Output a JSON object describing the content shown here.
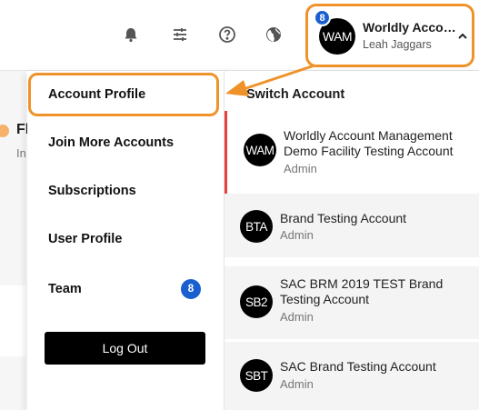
{
  "topbar": {
    "icons": [
      "bell-icon",
      "sliders-icon",
      "help-icon",
      "globe-icon"
    ],
    "account": {
      "avatar_text": "WAM",
      "badge": "8",
      "name": "Worldly Account Management",
      "user": "Leah Jaggars",
      "caret": "chevron-up-icon"
    }
  },
  "background": {
    "heading_fragment": "Fl",
    "sub_fragment": "In"
  },
  "menu": {
    "items": [
      {
        "label": "Account Profile"
      },
      {
        "label": "Join More Accounts"
      },
      {
        "label": "Subscriptions"
      },
      {
        "label": "User Profile"
      },
      {
        "label": "Team",
        "badge": "8"
      }
    ],
    "logout_label": "Log Out"
  },
  "switch": {
    "title": "Switch Account",
    "accounts": [
      {
        "avatar": "WAM",
        "name": "Worldly Account Management Demo Facility Testing Account",
        "role": "Admin",
        "active": true
      },
      {
        "avatar": "BTA",
        "name": "Brand Testing Account",
        "role": "Admin",
        "active": false
      },
      {
        "avatar": "SB2",
        "name": "SAC BRM 2019 TEST Brand Testing Account",
        "role": "Admin",
        "active": false
      },
      {
        "avatar": "SBT",
        "name": "SAC Brand Testing Account",
        "role": "Admin",
        "active": false
      }
    ]
  },
  "colors": {
    "highlight": "#f0922a",
    "badge": "#1a5fd0",
    "active_marker": "#e8413c"
  }
}
